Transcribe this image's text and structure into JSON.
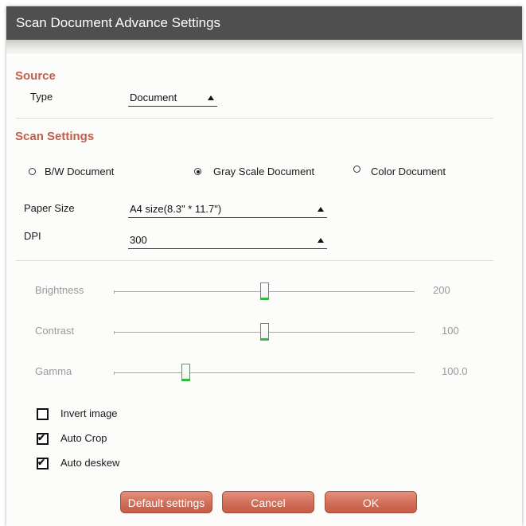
{
  "title": "Scan Document Advance Settings",
  "source": {
    "heading": "Source",
    "type_label": "Type",
    "type_value": "Document"
  },
  "scan_settings": {
    "heading": "Scan Settings",
    "color_modes": [
      {
        "label": "B/W Document",
        "selected": false
      },
      {
        "label": "Gray Scale Document",
        "selected": true
      },
      {
        "label": "Color Document",
        "selected": false
      }
    ],
    "paper_size_label": "Paper Size",
    "paper_size_value": "A4 size(8.3\" * 11.7\")",
    "dpi_label": "DPI",
    "dpi_value": "300"
  },
  "sliders": [
    {
      "label": "Brightness",
      "value": "200",
      "level": 0.5
    },
    {
      "label": "Contrast",
      "value": "100",
      "level": 0.5
    },
    {
      "label": "Gamma",
      "value": "100.0",
      "level": 0.24
    }
  ],
  "options": [
    {
      "label": "Invert image",
      "checked": false
    },
    {
      "label": "Auto Crop",
      "checked": true
    },
    {
      "label": "Auto deskew",
      "checked": true
    }
  ],
  "buttons": {
    "default_label": "Default settings",
    "cancel_label": "Cancel",
    "ok_label": "OK"
  },
  "colors": {
    "heading": "#c0604a",
    "button": "#cf6b56",
    "slider_thumb_accent": "#2fbf3a",
    "titlebar": "#4f4f4f"
  }
}
